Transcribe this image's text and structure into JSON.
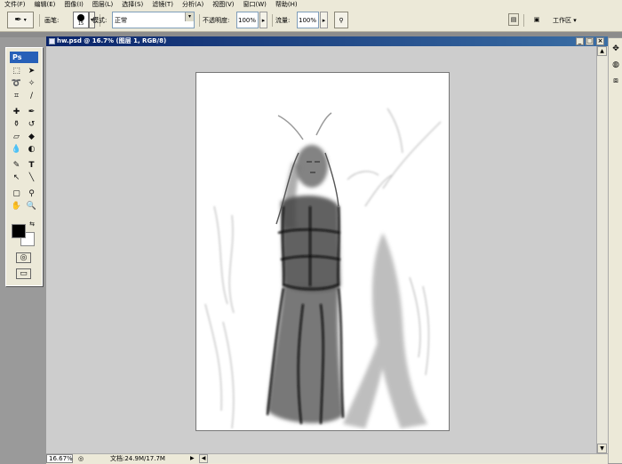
{
  "menu": [
    "文件(F)",
    "编辑(E)",
    "图像(I)",
    "图层(L)",
    "选择(S)",
    "滤镜(T)",
    "分析(A)",
    "视图(V)",
    "窗口(W)",
    "帮助(H)"
  ],
  "options": {
    "brush_label": "画笔:",
    "brush_size": "15",
    "mode_label": "模式:",
    "mode_value": "正常",
    "opacity_label": "不透明度:",
    "opacity_value": "100%",
    "flow_label": "流量:",
    "flow_value": "100%",
    "workspace_label": "工作区 ▾"
  },
  "toolbox": {
    "logo": "Ps"
  },
  "icons": {
    "brush_tool": "✒",
    "airbrush": "⚲",
    "palette_well": "▤",
    "workspace": "▣"
  },
  "document": {
    "title": "hw.psd @ 16.7% (图层 1, RGB/8)",
    "minimize": "_",
    "maximize": "□",
    "close": "×"
  },
  "status": {
    "zoom": "16.67%",
    "doc_size": "文档:24.9M/17.7M",
    "arrow": "▶"
  },
  "colors": {
    "foreground": "#000000",
    "background": "#ffffff"
  }
}
